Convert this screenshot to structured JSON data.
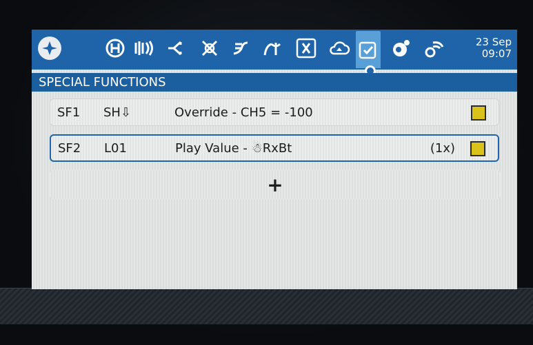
{
  "header": {
    "date": "23 Sep",
    "time": "09:07",
    "icons": [
      "home-icon",
      "heli-setup-icon",
      "flight-modes-icon",
      "inputs-icon",
      "mixes-icon",
      "outputs-icon",
      "curves-icon",
      "logical-switches-icon",
      "cloud-icon",
      "special-functions-icon",
      "telemetry-icon",
      "radio-wireless-icon"
    ]
  },
  "title": "SPECIAL FUNCTIONS",
  "functions": [
    {
      "id": "SF1",
      "switch": "SH⇩",
      "action": "Override - CH5 = -100",
      "repeat": ""
    },
    {
      "id": "SF2",
      "switch": "L01",
      "action": "Play Value - ☃RxBt",
      "repeat": "(1x)"
    }
  ],
  "add_label": "+",
  "colors": {
    "header": "#1f63a8",
    "active_tab": "#5aa0d8",
    "enabled_box": "#d8c21b"
  }
}
